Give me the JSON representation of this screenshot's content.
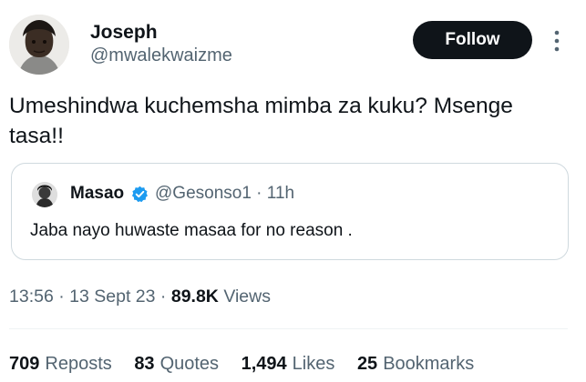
{
  "author": {
    "name": "Joseph",
    "handle": "@mwalekwaizme",
    "avatar_icon": "user-avatar-icon"
  },
  "follow_button": {
    "label": "Follow",
    "bg": "#0f1419",
    "fg": "#ffffff"
  },
  "more_icon": "more-vertical-icon",
  "tweet": {
    "text": "Umeshindwa kuchemsha mimba za kuku? Msenge tasa!!"
  },
  "quote": {
    "name": "Masao",
    "verified": true,
    "verified_icon": "verified-badge-icon",
    "verified_color": "#1d9bf0",
    "handle_time": "@Gesonso1 · 11h",
    "text": "Jaba nayo huwaste masaa for no reason ."
  },
  "meta": {
    "time": "13:56",
    "date": "13 Sept 23",
    "views_count": "89.8K",
    "views_label": "Views"
  },
  "stats": [
    {
      "count": "709",
      "label": "Reposts"
    },
    {
      "count": "83",
      "label": "Quotes"
    },
    {
      "count": "1,494",
      "label": "Likes"
    },
    {
      "count": "25",
      "label": "Bookmarks"
    }
  ],
  "colors": {
    "text": "#0f1419",
    "secondary": "#536471",
    "border": "#cfd9de"
  }
}
